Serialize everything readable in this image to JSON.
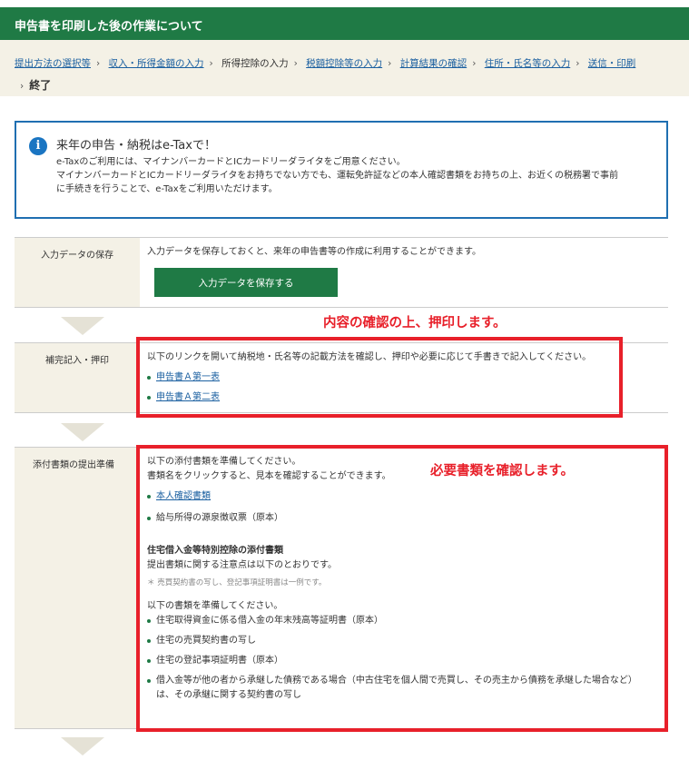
{
  "header": {
    "title": "申告書を印刷した後の作業について"
  },
  "breadcrumb": {
    "items": [
      {
        "label": "提出方法の選択等",
        "link": true
      },
      {
        "label": "収入・所得金額の入力",
        "link": true
      },
      {
        "label": "所得控除の入力",
        "link": false
      },
      {
        "label": "税額控除等の入力",
        "link": true
      },
      {
        "label": "計算結果の確認",
        "link": true
      },
      {
        "label": "住所・氏名等の入力",
        "link": true
      },
      {
        "label": "送信・印刷",
        "link": true
      }
    ],
    "final": "終了"
  },
  "info": {
    "icon": "info-icon",
    "title": "来年の申告・納税はe-Taxで！",
    "line1": "e-Taxのご利用には、マイナンバーカードとICカードリーダライタをご用意ください。",
    "line2": "マイナンバーカードとICカードリーダライタをお持ちでない方でも、運転免許証などの本人確認書類をお持ちの上、お近くの税務署で事前",
    "line3": "に手続きを行うことで、e-Taxをご利用いただけます。"
  },
  "save_section": {
    "label": "入力データの保存",
    "text": "入力データを保存しておくと、来年の申告書等の作成に利用することができます。",
    "button": "入力データを保存する"
  },
  "stamp_section": {
    "label": "補完記入・押印",
    "text": "以下のリンクを開いて納税地・氏名等の記載方法を確認し、押印や必要に応じて手書きで記入してください。",
    "links": [
      "申告書Ａ第一表",
      "申告書Ａ第二表"
    ],
    "annotation": "内容の確認の上、押印します。"
  },
  "attach_section": {
    "label": "添付書類の提出準備",
    "intro1": "以下の添付書類を準備してください。",
    "intro2": "書類名をクリックすると、見本を確認することができます。",
    "doc_link": "本人確認書類",
    "doc_plain": "給与所得の源泉徴収票（原本）",
    "housing_title": "住宅借入金等特別控除の添付書類",
    "housing_desc": "提出書類に関する注意点は以下のとおりです。",
    "housing_note": "＊ 売買契約書の写し、登記事項証明書は一例です。",
    "prepare": "以下の書類を準備してください。",
    "items": [
      "住宅取得資金に係る借入金の年末残高等証明書（原本）",
      "住宅の売買契約書の写し",
      "住宅の登記事項証明書（原本）"
    ],
    "last_item_line1": "借入金等が他の者から承継した債務である場合（中古住宅を個人間で売買し、その売主から債務を承継した場合など）",
    "last_item_line2": "は、その承継に関する契約書の写し",
    "annotation": "必要書類を確認します。"
  },
  "colors": {
    "header": "#1f7a45",
    "accent_red": "#e8202a",
    "info_border": "#1f6fb1",
    "label_bg": "#f4f1e6"
  }
}
